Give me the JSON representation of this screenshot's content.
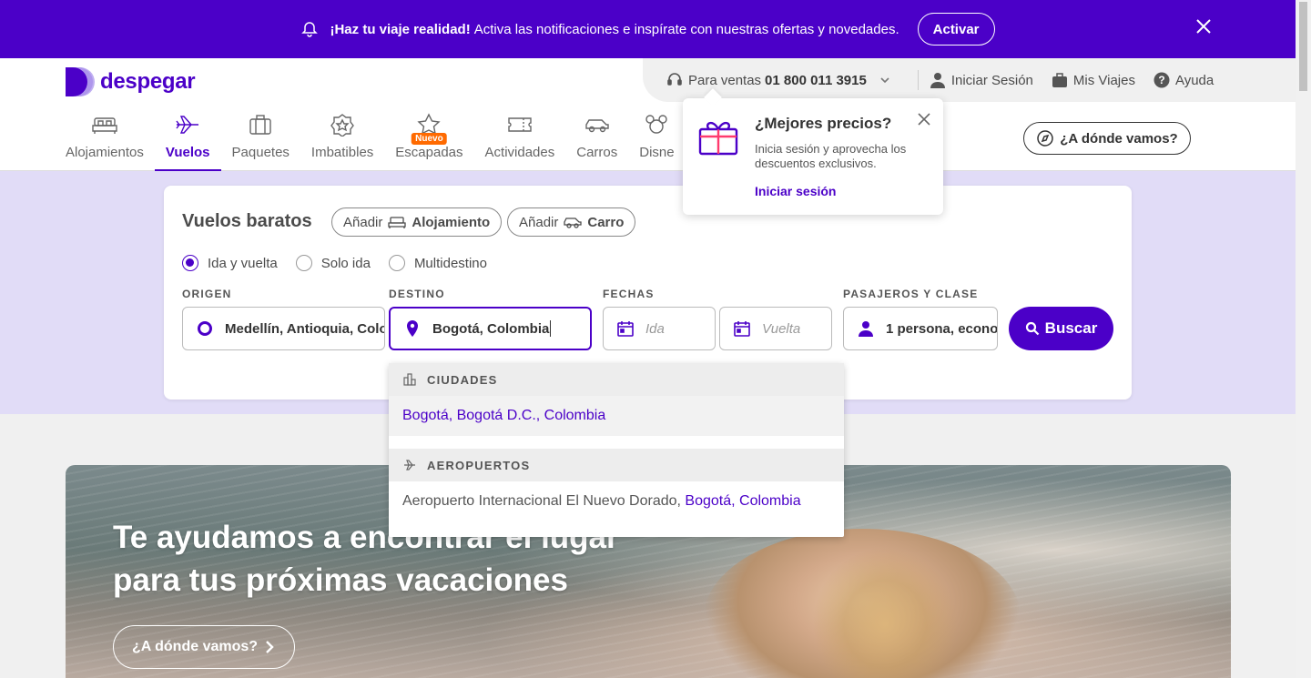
{
  "banner": {
    "headline": "¡Haz tu viaje realidad!",
    "message": "Activa las notificaciones e inspírate con nuestras ofertas y novedades.",
    "activate_label": "Activar"
  },
  "brand": {
    "name": "despegar",
    "color": "#4b00c8"
  },
  "utility": {
    "sales_label": "Para ventas",
    "sales_phone": "01 800 011 3915",
    "login_label": "Iniciar Sesión",
    "trips_label": "Mis Viajes",
    "help_label": "Ayuda"
  },
  "nav": {
    "tabs": [
      {
        "label": "Alojamientos",
        "icon": "bed-icon"
      },
      {
        "label": "Vuelos",
        "icon": "plane-icon",
        "active": true
      },
      {
        "label": "Paquetes",
        "icon": "suitcase-icon"
      },
      {
        "label": "Imbatibles",
        "icon": "badge-icon"
      },
      {
        "label": "Escapadas",
        "icon": "star-icon",
        "badge": "Nuevo"
      },
      {
        "label": "Actividades",
        "icon": "ticket-icon"
      },
      {
        "label": "Carros",
        "icon": "car-icon"
      },
      {
        "label": "Disne",
        "icon": "mickey-icon"
      }
    ],
    "explore_label": "¿A dónde vamos?"
  },
  "popover": {
    "title": "¿Mejores precios?",
    "description": "Inicia sesión y aprovecha los descuentos exclusivos.",
    "link": "Iniciar sesión"
  },
  "search": {
    "title": "Vuelos baratos",
    "add_prefix": "Añadir",
    "add_hotel": "Alojamiento",
    "add_car": "Carro",
    "trip_types": [
      "Ida y vuelta",
      "Solo ida",
      "Multidestino"
    ],
    "selected_trip_type": "Ida y vuelta",
    "origin_label": "ORIGEN",
    "origin_value": "Medellín, Antioquia, Colo",
    "destination_label": "DESTINO",
    "destination_value": "Bogotá, Colombia",
    "dates_label": "FECHAS",
    "depart_placeholder": "Ida",
    "return_placeholder": "Vuelta",
    "passengers_label": "PASAJEROS Y CLASE",
    "passengers_value": "1 persona, econo",
    "search_label": "Buscar"
  },
  "dropdown": {
    "cities_header": "CIUDADES",
    "city_result": "Bogotá, Bogotá D.C., Colombia",
    "airports_header": "AEROPUERTOS",
    "airport_name": "Aeropuerto Internacional El Nuevo Dorado,",
    "airport_place": "Bogotá, Colombia"
  },
  "hero": {
    "line1": "Te ayudamos a encontrar el lugar",
    "line2": "para tus próximas vacaciones",
    "cta": "¿A dónde vamos?"
  }
}
